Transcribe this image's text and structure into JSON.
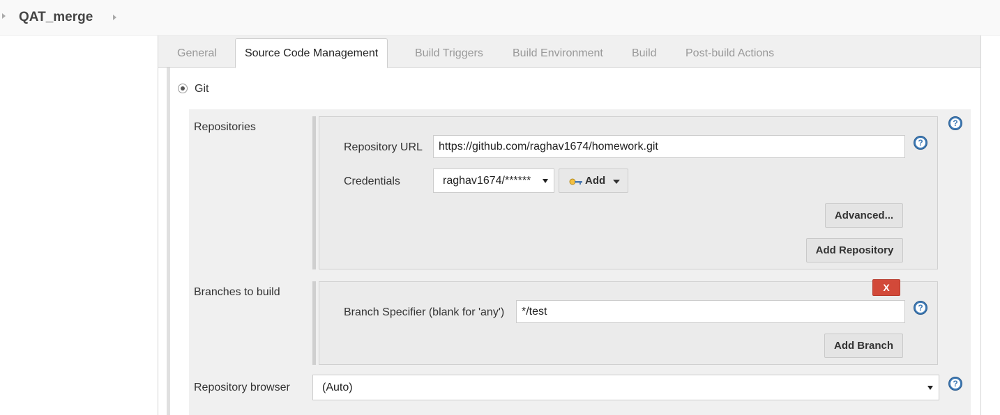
{
  "breadcrumb": {
    "job_name": "QAT_merge"
  },
  "tabs": [
    {
      "label": "General"
    },
    {
      "label": "Source Code Management"
    },
    {
      "label": "Build Triggers"
    },
    {
      "label": "Build Environment"
    },
    {
      "label": "Build"
    },
    {
      "label": "Post-build Actions"
    }
  ],
  "active_tab": "Source Code Management",
  "scm": {
    "option_label": "Git",
    "repositories": {
      "label": "Repositories",
      "url_label": "Repository URL",
      "url_value": "https://github.com/raghav1674/homework.git",
      "credentials_label": "Credentials",
      "credentials_value": "raghav1674/******",
      "add_label": "Add",
      "advanced_label": "Advanced...",
      "add_repository_label": "Add Repository"
    },
    "branches": {
      "label": "Branches to build",
      "delete_label": "X",
      "specifier_label": "Branch Specifier (blank for 'any')",
      "specifier_value": "*/test",
      "add_branch_label": "Add Branch"
    },
    "browser": {
      "label": "Repository browser",
      "value": "(Auto)"
    }
  },
  "help_glyph": "?",
  "colors": {
    "help": "#3e7ab5",
    "delete": "#d24939",
    "panel_bg": "#f0f0f0"
  },
  "icons": {
    "help": "question-circle-icon",
    "credentials": "key-icon",
    "delete": "close-icon"
  }
}
